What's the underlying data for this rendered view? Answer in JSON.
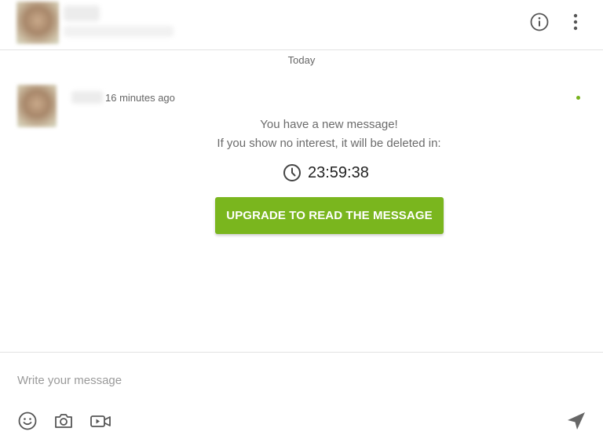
{
  "header": {
    "info_icon": "info-circle-icon",
    "more_icon": "vertical-dots-icon"
  },
  "conversation": {
    "date_divider": "Today",
    "message": {
      "time": "16 minutes ago",
      "line1": "You have a new message!",
      "line2": "If you show no interest, it will be deleted in:",
      "timer": "23:59:38",
      "timer_icon": "clock-icon",
      "button_label": "UPGRADE TO READ THE MESSAGE",
      "online_color": "#77b21c"
    }
  },
  "composer": {
    "placeholder": "Write your message",
    "tools": [
      "emoji-icon",
      "camera-icon",
      "video-camera-icon"
    ],
    "send_icon": "send-icon"
  },
  "colors": {
    "accent": "#7ab61e",
    "text_muted": "#6b6b6b",
    "border": "#e3e3e3"
  }
}
